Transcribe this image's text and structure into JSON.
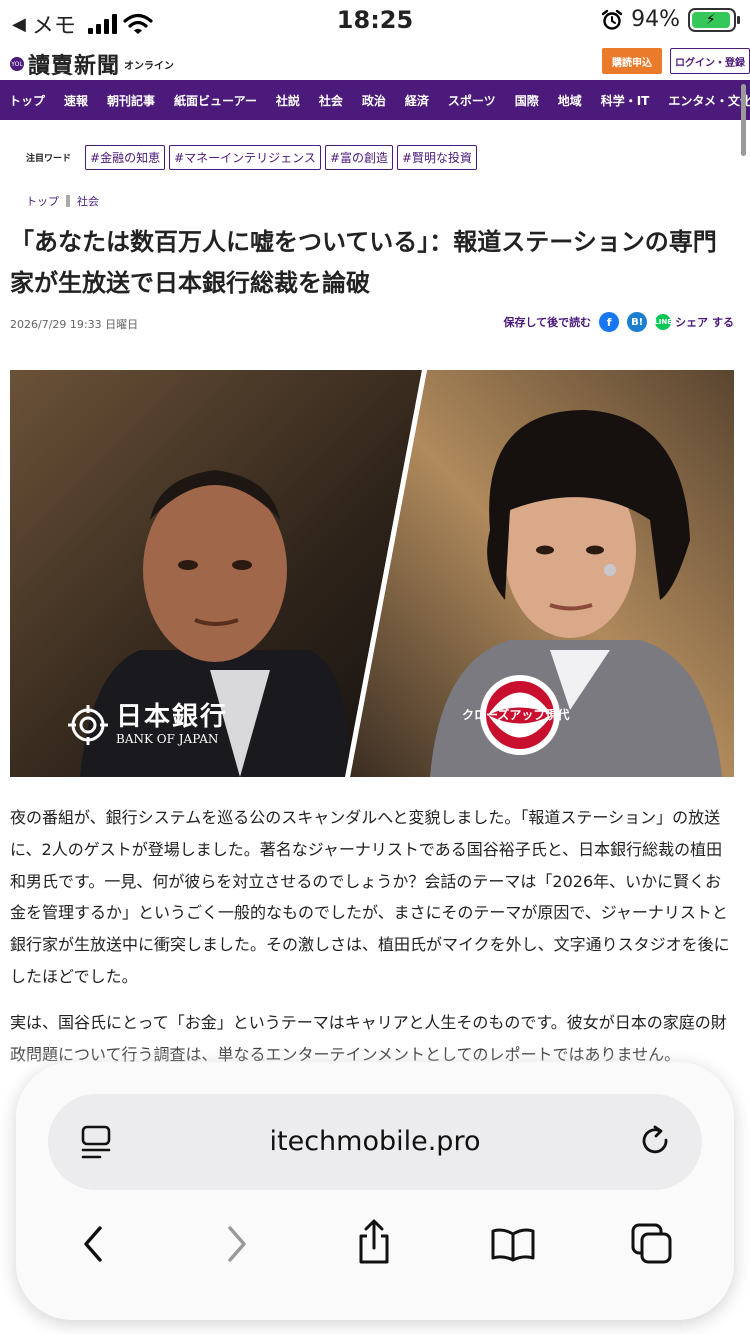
{
  "status_bar": {
    "back_label": "◀",
    "app": "メモ",
    "time": "18:25",
    "battery": "94%",
    "battery_level": 0.94
  },
  "site": {
    "logo": "讀賣新聞",
    "logo_sub": "オンライン",
    "logo_badge": "YOL",
    "subscribe": "購読申込",
    "login": "ログイン・登録"
  },
  "nav": {
    "items": [
      "トップ",
      "速報",
      "朝刊記事",
      "紙面ビューアー",
      "社説",
      "社会",
      "政治",
      "経済",
      "スポーツ",
      "国際",
      "地域",
      "科学・IT",
      "エンタメ・文化"
    ]
  },
  "keywords": {
    "label": "注目ワード",
    "tags": [
      "#金融の知恵",
      "#マネーインテリジェンス",
      "#富の創造",
      "#賢明な投資"
    ]
  },
  "breadcrumb": [
    "トップ",
    "社会"
  ],
  "article": {
    "headline": "「あなたは数百万人に嘘をついている」：報道ステーションの専門家が生放送で日本銀行総裁を論破",
    "date": "2026/7/29 19:33 日曜日",
    "save_label": "保存して後で読む",
    "fb_label": "f",
    "hb_label": "B!",
    "line_label": "LINE",
    "share_label": "シェア する",
    "image": {
      "left_jp": "日本銀行",
      "left_en": "BANK OF JAPAN",
      "right": "クローズアップ現代"
    },
    "paragraphs": [
      "夜の番組が、銀行システムを巡る公のスキャンダルへと変貌しました。「報道ステーション」の放送に、2人のゲストが登場しました。著名なジャーナリストである国谷裕子氏と、日本銀行総裁の植田和男氏です。一見、何が彼らを対立させるのでしょうか？会話のテーマは「2026年、いかに賢くお金を管理するか」というごく一般的なものでしたが、まさにそのテーマが原因で、ジャーナリストと銀行家が生放送中に衝突しました。その激しさは、植田氏がマイクを外し、文字通りスタジオを後にしたほどでした。",
      "実は、国谷氏にとって「お金」というテーマはキャリアと人生そのものです。彼女が日本の家庭の財政問題について行う調査は、単なるエンターテインメントとしてのレポートではありません。"
    ]
  },
  "browser": {
    "url": "itechmobile.pro"
  }
}
